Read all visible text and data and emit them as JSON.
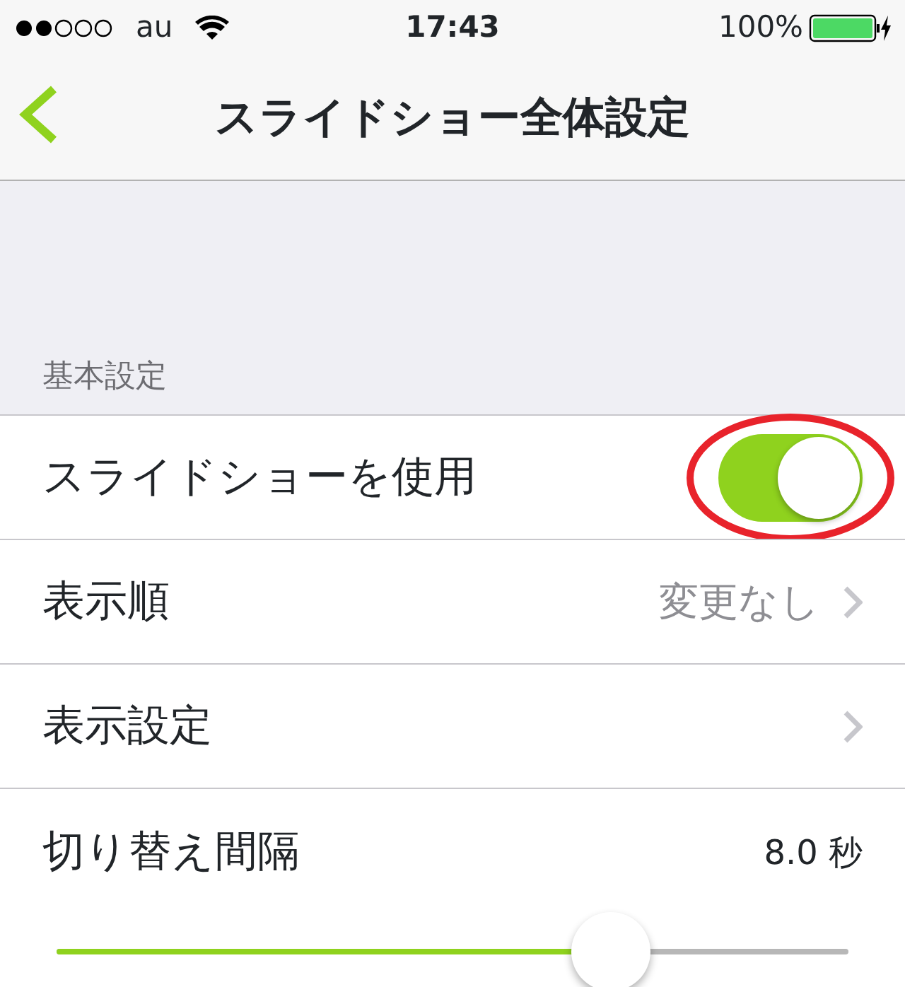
{
  "status_bar": {
    "carrier": "au",
    "time": "17:43",
    "battery": "100%"
  },
  "nav": {
    "title": "スライドショー全体設定"
  },
  "section": {
    "header": "基本設定"
  },
  "rows": [
    {
      "kind": "toggle",
      "label": "スライドショーを使用",
      "on": true,
      "highlighted": true
    },
    {
      "kind": "detail",
      "label": "表示順",
      "value": "変更なし"
    },
    {
      "kind": "detail",
      "label": "表示設定"
    },
    {
      "kind": "slider",
      "label": "切り替え間隔",
      "reading": "8.0 秒",
      "level": 0.7
    }
  ]
}
